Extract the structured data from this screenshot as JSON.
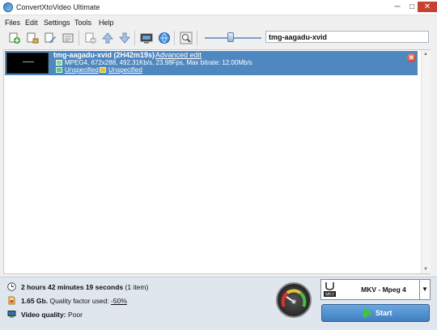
{
  "window": {
    "title": "ConvertXtoVideo Ultimate",
    "minimize": "─",
    "maximize": "□",
    "close": "✕"
  },
  "menu": {
    "items": [
      "Files",
      "Edit",
      "Settings",
      "Tools",
      "Help"
    ]
  },
  "toolbar": {
    "icons": [
      "add-file-icon",
      "add-folder-icon",
      "edit-icon",
      "properties-icon",
      "remove-icon",
      "move-up-icon",
      "move-down-icon",
      "preview-icon",
      "globe-icon",
      "magnifier-icon"
    ],
    "slider_level": 0.45,
    "search_value": "tmg-aagadu-xvid"
  },
  "file": {
    "title": "tmg-aagadu-xvid (2H42m19s)",
    "advanced_edit": "Advanced edit",
    "meta": "MPEG4, 672x288, 492.31Kb/s, 23.98Fps, Max bitrate: 12.00Mb/s",
    "audio_track": "Unspecified",
    "subtitle_track": "Unspecified"
  },
  "status": {
    "duration": "2 hours 42 minutes 19 seconds",
    "items": "(1 item)",
    "size": "1.65 Gb.",
    "quality_factor_label": "Quality factor used:",
    "quality_factor": "-50%",
    "video_quality_label": "Video quality:",
    "video_quality": "Poor"
  },
  "output": {
    "format": "MKV - Mpeg 4",
    "format_badge": "MKV",
    "start": "Start"
  },
  "colors": {
    "selection": "#4f88c0",
    "start_button": "#4f8fd0",
    "start_arrow": "#3ec73a",
    "remove": "#c8281a"
  }
}
